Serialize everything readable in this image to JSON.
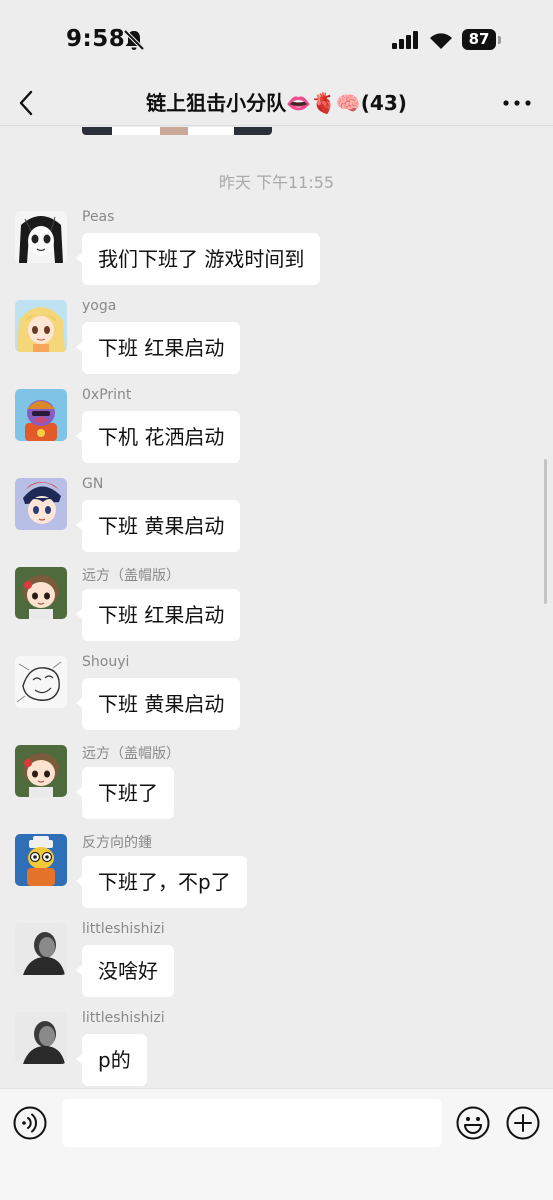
{
  "status_bar": {
    "time": "9:58",
    "battery": "87",
    "icons": [
      "bell-slash-icon",
      "signal-icon",
      "wifi-icon",
      "battery-icon"
    ]
  },
  "header": {
    "title": "链上狙击小分队👄🫀🧠(43)",
    "back_icon": "chevron-left-icon",
    "more_icon": "more-dots-icon"
  },
  "chat": {
    "timestamp": "昨天 下午11:55",
    "messages": [
      {
        "sender": "Peas",
        "text": "我们下班了  游戏时间到",
        "avatar": "manga-girl-avatar"
      },
      {
        "sender": "yoga",
        "text": "下班 红果启动",
        "avatar": "anime-blonde-avatar"
      },
      {
        "sender": "0xPrint",
        "text": "下机 花洒启动",
        "avatar": "cartoon-character-avatar"
      },
      {
        "sender": "GN",
        "text": "下班 黄果启动",
        "avatar": "anime-boy-avatar"
      },
      {
        "sender": "远方（盖帽版）",
        "text": "下班 红果启动",
        "avatar": "chibi-avatar"
      },
      {
        "sender": "Shouyi",
        "text": "下班 黄果启动",
        "avatar": "sketch-avatar"
      },
      {
        "sender": "远方（盖帽版）",
        "text": "下班了",
        "avatar": "chibi-avatar"
      },
      {
        "sender": "反方向的鍾",
        "text": "下班了，不p了",
        "avatar": "cartoon-robot-avatar"
      },
      {
        "sender": "littleshishizi",
        "text": "没啥好",
        "avatar": "bw-photo-avatar"
      },
      {
        "sender": "littleshishizi",
        "text": "p的",
        "avatar": "bw-photo-avatar"
      }
    ]
  },
  "input_bar": {
    "value": "",
    "voice_icon": "voice-icon",
    "emoji_icon": "emoji-icon",
    "plus_icon": "plus-icon"
  },
  "colors": {
    "background": "#ededed",
    "bubble": "#ffffff",
    "sender_name": "#8a8a8a",
    "timestamp": "#a9a9a9"
  }
}
